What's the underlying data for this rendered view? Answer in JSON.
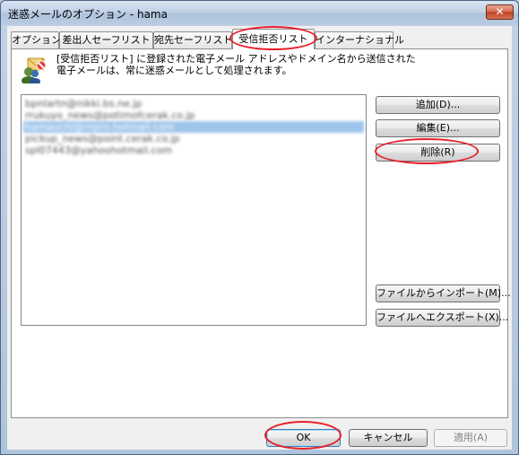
{
  "window": {
    "title": "迷惑メールのオプション - hama",
    "close_label": "✕"
  },
  "tabs": [
    {
      "label": "オプション"
    },
    {
      "label": "差出人セーフリスト"
    },
    {
      "label": "宛先セーフリスト"
    },
    {
      "label": "受信拒否リスト",
      "active": true
    },
    {
      "label": "インターナショナル"
    }
  ],
  "description": {
    "line1": "[受信拒否リスト] に登録された電子メール アドレスやドメイン名から送信された",
    "line2": "電子メールは、常に迷惑メールとして処理されます。"
  },
  "list": {
    "items": [
      {
        "text": "bpnlartn@nikki.bs.ne.jp",
        "selected": false
      },
      {
        "text": "rrukuyo_news@potimofcerak.co.jp",
        "selected": false
      },
      {
        "text": "hamauchi@rnpro.hotmail.com",
        "selected": true
      },
      {
        "text": "pickup_news@point.cerak.co.jp",
        "selected": false
      },
      {
        "text": "spl07443@yahoohotmail.com",
        "selected": false
      }
    ]
  },
  "buttons": {
    "add": "追加(D)...",
    "edit": "編集(E)...",
    "delete": "削除(R)",
    "import": "ファイルからインポート(M)...",
    "export": "ファイルへエクスポート(X)..."
  },
  "footer": {
    "ok": "OK",
    "cancel": "キャンセル",
    "apply": "適用(A)"
  },
  "colors": {
    "highlight_ellipse": "#e8202a",
    "selection": "#9ec4ea"
  }
}
